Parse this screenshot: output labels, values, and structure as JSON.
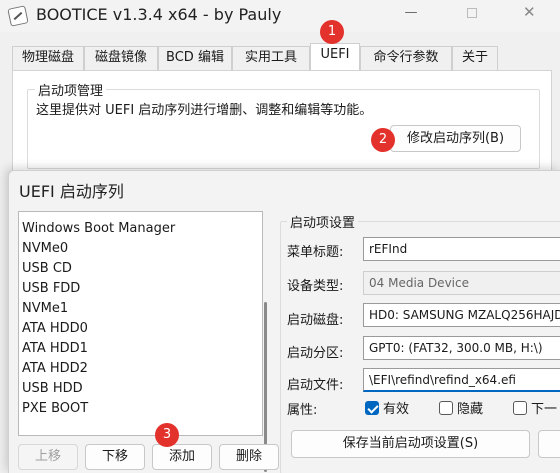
{
  "window": {
    "title": "BOOTICE v1.3.4 x64 - by Pauly",
    "minimize": "—",
    "close": "✕"
  },
  "tabs": [
    "物理磁盘",
    "磁盘镜像",
    "BCD 编辑",
    "实用工具",
    "UEFI",
    "命令行参数",
    "关于"
  ],
  "active_tab": "UEFI",
  "boot_mgr": {
    "title": "启动项管理",
    "description": "这里提供对 UEFI 启动序列进行增删、调整和编辑等功能。",
    "button": "修改启动序列(B)"
  },
  "badges": [
    "1",
    "2",
    "3"
  ],
  "dialog": {
    "title": "UEFI 启动序列",
    "boot_entries": [
      "Windows Boot Manager",
      "NVMe0",
      "USB CD",
      "USB FDD",
      "NVMe1",
      "ATA HDD0",
      "ATA HDD1",
      "ATA HDD2",
      "USB HDD",
      "PXE BOOT"
    ],
    "buttons": {
      "up": "上移",
      "down": "下移",
      "add": "添加",
      "delete": "删除"
    },
    "settings": {
      "group_title": "启动项设置",
      "menu_title_label": "菜单标题:",
      "menu_title_value": "rEFInd",
      "device_type_label": "设备类型:",
      "device_type_value": "04 Media Device",
      "boot_disk_label": "启动磁盘:",
      "boot_disk_value": "HD0: SAMSUNG MZALQ256HAJD",
      "boot_partition_label": "启动分区:",
      "boot_partition_value": "GPT0: (FAT32, 300.0 MB, H:\\)",
      "boot_file_label": "启动文件:",
      "boot_file_value": "\\EFI\\refind\\refind_x64.efi",
      "attributes_label": "属性:",
      "attr_valid": "有效",
      "attr_hidden": "隐藏",
      "attr_next": "下一",
      "save_button": "保存当前启动项设置(S)"
    }
  },
  "colors": {
    "badge": "#e3312b",
    "accent": "#0067c0"
  }
}
